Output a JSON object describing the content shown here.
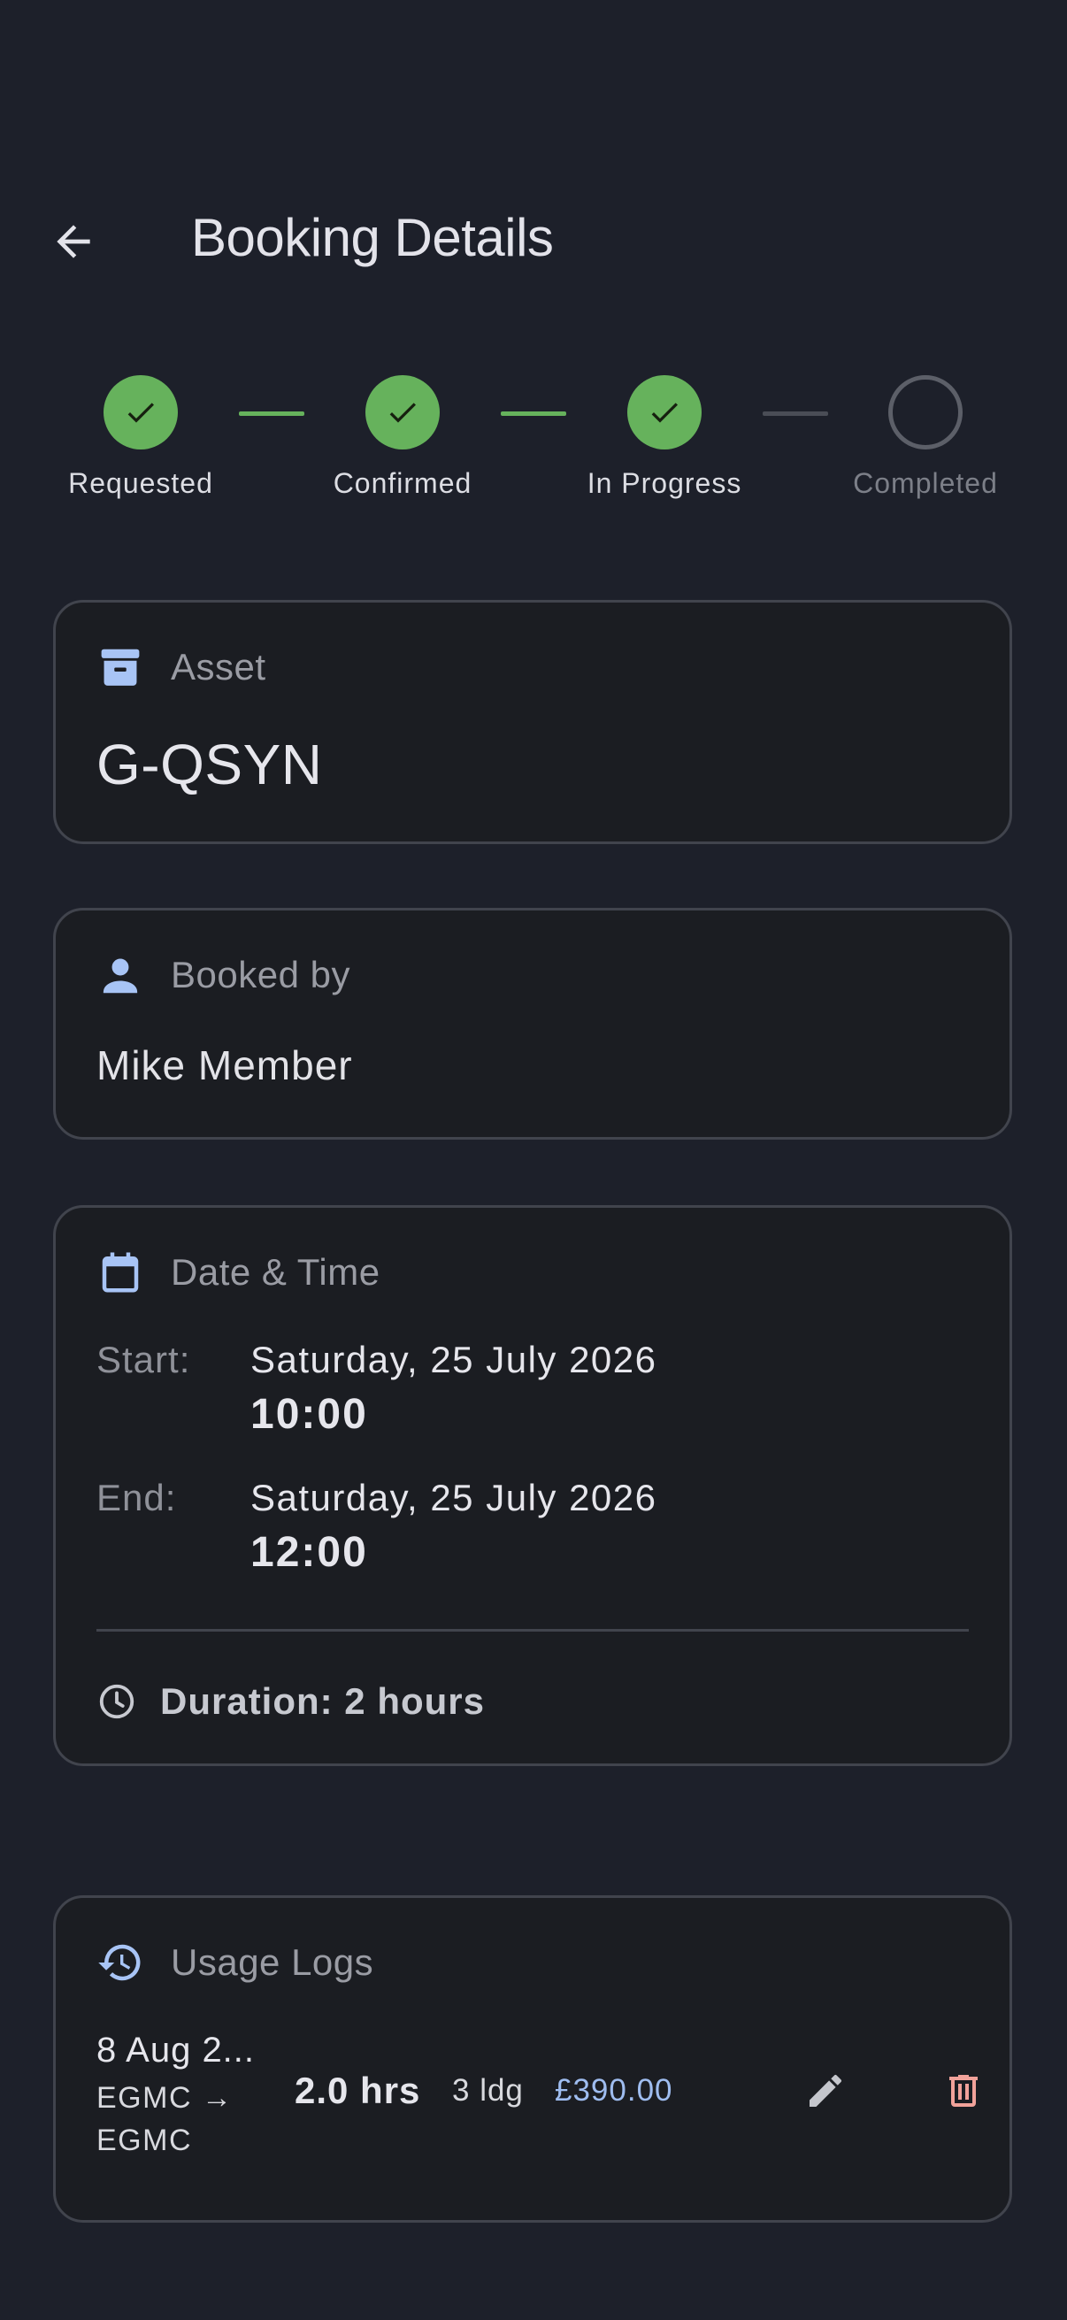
{
  "header": {
    "back_icon": "arrow-back-icon",
    "title": "Booking Details"
  },
  "colors": {
    "background": "#1d202a",
    "card": "#1b1d22",
    "success": "#66b25c",
    "accent_blue": "#9fbdf0",
    "delete_red": "#f1a29a"
  },
  "stepper": {
    "steps": [
      {
        "label": "Requested",
        "state": "complete"
      },
      {
        "label": "Confirmed",
        "state": "complete"
      },
      {
        "label": "In Progress",
        "state": "complete"
      },
      {
        "label": "Completed",
        "state": "pending"
      }
    ]
  },
  "asset_card": {
    "icon": "archive-box-icon",
    "label": "Asset",
    "value": "G-QSYN"
  },
  "booked_by_card": {
    "icon": "person-icon",
    "label": "Booked by",
    "value": "Mike Member"
  },
  "datetime_card": {
    "icon": "calendar-icon",
    "label": "Date & Time",
    "start": {
      "key": "Start:",
      "date": "Saturday, 25 July 2026",
      "time": "10:00"
    },
    "end": {
      "key": "End:",
      "date": "Saturday, 25 July 2026",
      "time": "12:00"
    },
    "duration": {
      "icon": "clock-icon",
      "text": "Duration: 2 hours"
    }
  },
  "usage_logs_card": {
    "icon": "history-icon",
    "label": "Usage Logs",
    "logs": [
      {
        "date": "8 Aug 2...",
        "route": "EGMC → EGMC",
        "hours": "2.0 hrs",
        "landings": "3 ldg",
        "price": "£390.00",
        "edit_icon": "pencil-icon",
        "delete_icon": "trash-icon"
      }
    ]
  }
}
